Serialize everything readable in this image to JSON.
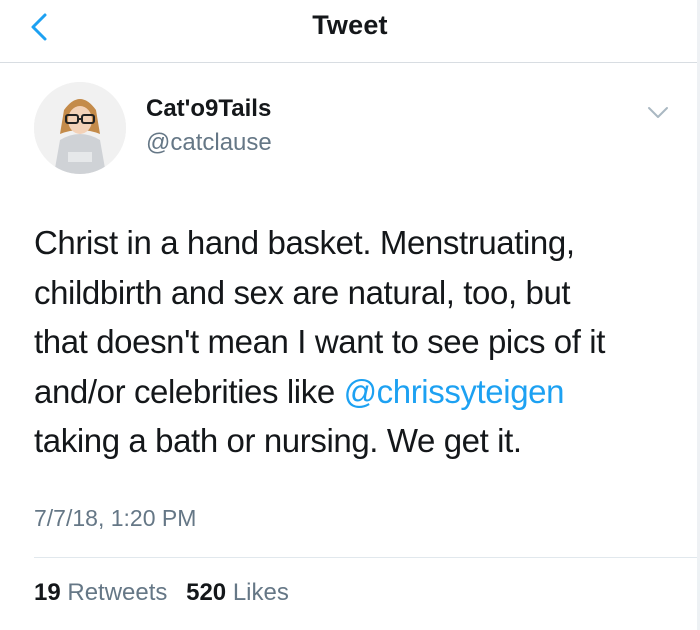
{
  "header": {
    "title": "Tweet",
    "back_icon": "chevron-left-icon"
  },
  "tweet": {
    "author_name": "Cat'o9Tails",
    "author_handle": "@catclause",
    "menu_icon": "chevron-down-icon",
    "lines": [
      "Christ in a hand basket. Menstruating,",
      "childbirth and sex are natural, too, but",
      "that doesn't mean I want to see pics of it",
      "and/or celebrities like ",
      "taking a bath or nursing. We get it."
    ],
    "mention": "@chrissyteigen",
    "timestamp": "7/7/18, 1:20 PM"
  },
  "stats": {
    "retweets_count": "19",
    "retweets_label": "Retweets",
    "likes_count": "520",
    "likes_label": "Likes"
  },
  "colors": {
    "accent": "#1da1f2",
    "secondary_text": "#657786",
    "primary_text": "#14171a"
  }
}
